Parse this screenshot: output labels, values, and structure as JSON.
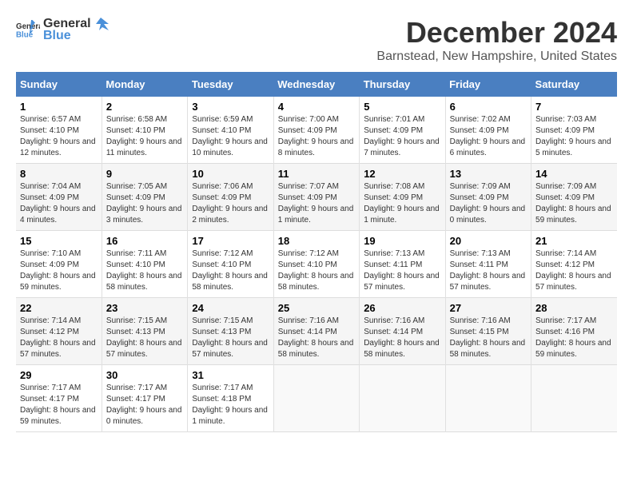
{
  "header": {
    "logo_general": "General",
    "logo_blue": "Blue",
    "month_title": "December 2024",
    "location": "Barnstead, New Hampshire, United States"
  },
  "weekdays": [
    "Sunday",
    "Monday",
    "Tuesday",
    "Wednesday",
    "Thursday",
    "Friday",
    "Saturday"
  ],
  "weeks": [
    [
      {
        "day": "1",
        "sunrise": "Sunrise: 6:57 AM",
        "sunset": "Sunset: 4:10 PM",
        "daylight": "Daylight: 9 hours and 12 minutes."
      },
      {
        "day": "2",
        "sunrise": "Sunrise: 6:58 AM",
        "sunset": "Sunset: 4:10 PM",
        "daylight": "Daylight: 9 hours and 11 minutes."
      },
      {
        "day": "3",
        "sunrise": "Sunrise: 6:59 AM",
        "sunset": "Sunset: 4:10 PM",
        "daylight": "Daylight: 9 hours and 10 minutes."
      },
      {
        "day": "4",
        "sunrise": "Sunrise: 7:00 AM",
        "sunset": "Sunset: 4:09 PM",
        "daylight": "Daylight: 9 hours and 8 minutes."
      },
      {
        "day": "5",
        "sunrise": "Sunrise: 7:01 AM",
        "sunset": "Sunset: 4:09 PM",
        "daylight": "Daylight: 9 hours and 7 minutes."
      },
      {
        "day": "6",
        "sunrise": "Sunrise: 7:02 AM",
        "sunset": "Sunset: 4:09 PM",
        "daylight": "Daylight: 9 hours and 6 minutes."
      },
      {
        "day": "7",
        "sunrise": "Sunrise: 7:03 AM",
        "sunset": "Sunset: 4:09 PM",
        "daylight": "Daylight: 9 hours and 5 minutes."
      }
    ],
    [
      {
        "day": "8",
        "sunrise": "Sunrise: 7:04 AM",
        "sunset": "Sunset: 4:09 PM",
        "daylight": "Daylight: 9 hours and 4 minutes."
      },
      {
        "day": "9",
        "sunrise": "Sunrise: 7:05 AM",
        "sunset": "Sunset: 4:09 PM",
        "daylight": "Daylight: 9 hours and 3 minutes."
      },
      {
        "day": "10",
        "sunrise": "Sunrise: 7:06 AM",
        "sunset": "Sunset: 4:09 PM",
        "daylight": "Daylight: 9 hours and 2 minutes."
      },
      {
        "day": "11",
        "sunrise": "Sunrise: 7:07 AM",
        "sunset": "Sunset: 4:09 PM",
        "daylight": "Daylight: 9 hours and 1 minute."
      },
      {
        "day": "12",
        "sunrise": "Sunrise: 7:08 AM",
        "sunset": "Sunset: 4:09 PM",
        "daylight": "Daylight: 9 hours and 1 minute."
      },
      {
        "day": "13",
        "sunrise": "Sunrise: 7:09 AM",
        "sunset": "Sunset: 4:09 PM",
        "daylight": "Daylight: 9 hours and 0 minutes."
      },
      {
        "day": "14",
        "sunrise": "Sunrise: 7:09 AM",
        "sunset": "Sunset: 4:09 PM",
        "daylight": "Daylight: 8 hours and 59 minutes."
      }
    ],
    [
      {
        "day": "15",
        "sunrise": "Sunrise: 7:10 AM",
        "sunset": "Sunset: 4:09 PM",
        "daylight": "Daylight: 8 hours and 59 minutes."
      },
      {
        "day": "16",
        "sunrise": "Sunrise: 7:11 AM",
        "sunset": "Sunset: 4:10 PM",
        "daylight": "Daylight: 8 hours and 58 minutes."
      },
      {
        "day": "17",
        "sunrise": "Sunrise: 7:12 AM",
        "sunset": "Sunset: 4:10 PM",
        "daylight": "Daylight: 8 hours and 58 minutes."
      },
      {
        "day": "18",
        "sunrise": "Sunrise: 7:12 AM",
        "sunset": "Sunset: 4:10 PM",
        "daylight": "Daylight: 8 hours and 58 minutes."
      },
      {
        "day": "19",
        "sunrise": "Sunrise: 7:13 AM",
        "sunset": "Sunset: 4:11 PM",
        "daylight": "Daylight: 8 hours and 57 minutes."
      },
      {
        "day": "20",
        "sunrise": "Sunrise: 7:13 AM",
        "sunset": "Sunset: 4:11 PM",
        "daylight": "Daylight: 8 hours and 57 minutes."
      },
      {
        "day": "21",
        "sunrise": "Sunrise: 7:14 AM",
        "sunset": "Sunset: 4:12 PM",
        "daylight": "Daylight: 8 hours and 57 minutes."
      }
    ],
    [
      {
        "day": "22",
        "sunrise": "Sunrise: 7:14 AM",
        "sunset": "Sunset: 4:12 PM",
        "daylight": "Daylight: 8 hours and 57 minutes."
      },
      {
        "day": "23",
        "sunrise": "Sunrise: 7:15 AM",
        "sunset": "Sunset: 4:13 PM",
        "daylight": "Daylight: 8 hours and 57 minutes."
      },
      {
        "day": "24",
        "sunrise": "Sunrise: 7:15 AM",
        "sunset": "Sunset: 4:13 PM",
        "daylight": "Daylight: 8 hours and 57 minutes."
      },
      {
        "day": "25",
        "sunrise": "Sunrise: 7:16 AM",
        "sunset": "Sunset: 4:14 PM",
        "daylight": "Daylight: 8 hours and 58 minutes."
      },
      {
        "day": "26",
        "sunrise": "Sunrise: 7:16 AM",
        "sunset": "Sunset: 4:14 PM",
        "daylight": "Daylight: 8 hours and 58 minutes."
      },
      {
        "day": "27",
        "sunrise": "Sunrise: 7:16 AM",
        "sunset": "Sunset: 4:15 PM",
        "daylight": "Daylight: 8 hours and 58 minutes."
      },
      {
        "day": "28",
        "sunrise": "Sunrise: 7:17 AM",
        "sunset": "Sunset: 4:16 PM",
        "daylight": "Daylight: 8 hours and 59 minutes."
      }
    ],
    [
      {
        "day": "29",
        "sunrise": "Sunrise: 7:17 AM",
        "sunset": "Sunset: 4:17 PM",
        "daylight": "Daylight: 8 hours and 59 minutes."
      },
      {
        "day": "30",
        "sunrise": "Sunrise: 7:17 AM",
        "sunset": "Sunset: 4:17 PM",
        "daylight": "Daylight: 9 hours and 0 minutes."
      },
      {
        "day": "31",
        "sunrise": "Sunrise: 7:17 AM",
        "sunset": "Sunset: 4:18 PM",
        "daylight": "Daylight: 9 hours and 1 minute."
      },
      null,
      null,
      null,
      null
    ]
  ]
}
